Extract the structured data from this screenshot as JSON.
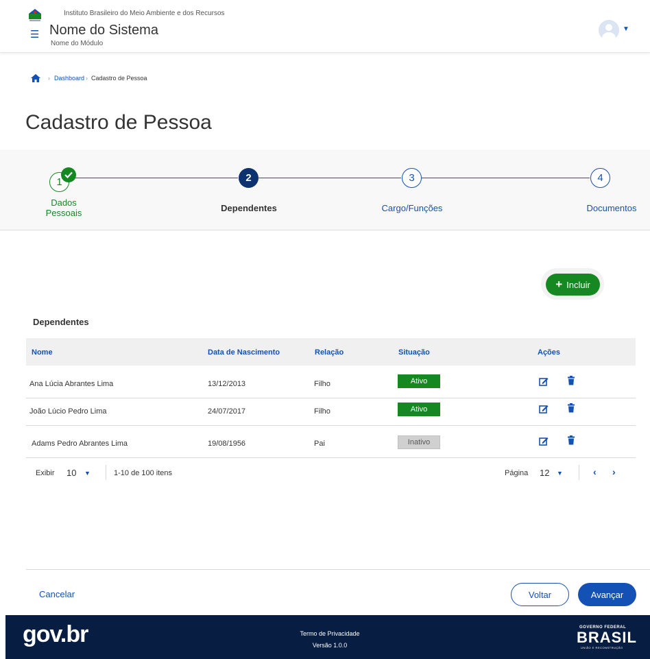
{
  "header": {
    "org_name": "Instituto Brasileiro do Meio Ambiente e dos Recursos",
    "system_name": "Nome do Sistema",
    "module_name": "Nome do Módulo"
  },
  "breadcrumb": {
    "items": [
      "Dashboard",
      "Cadastro de Pessoa"
    ]
  },
  "page": {
    "title": "Cadastro de Pessoa"
  },
  "stepper": {
    "steps": [
      {
        "number": "1",
        "label_line1": "Dados",
        "label_line2": "Pessoais",
        "state": "done"
      },
      {
        "number": "2",
        "label": "Dependentes",
        "state": "current"
      },
      {
        "number": "3",
        "label": "Cargo/Funções",
        "state": "todo"
      },
      {
        "number": "4",
        "label": "Documentos",
        "state": "todo"
      }
    ]
  },
  "toolbar": {
    "add_label": "Incluir"
  },
  "section": {
    "title": "Dependentes"
  },
  "table": {
    "headers": [
      "Nome",
      "Data de Nascimento",
      "Relação",
      "Situação",
      "Ações"
    ],
    "rows": [
      {
        "nome": "Ana Lúcia Abrantes Lima",
        "nascimento": "13/12/2013",
        "relacao": "Filho",
        "situacao": "Ativo"
      },
      {
        "nome": "João Lúcio Pedro Lima",
        "nascimento": "24/07/2017",
        "relacao": "Filho",
        "situacao": "Ativo"
      },
      {
        "nome": "Adams Pedro Abrantes Lima",
        "nascimento": "19/08/1956",
        "relacao": "Pai",
        "situacao": "Inativo"
      }
    ]
  },
  "pagination": {
    "show_label": "Exibir",
    "page_size": "10",
    "range_text": "1-10 de 100 itens",
    "page_label": "Página",
    "current_page": "12"
  },
  "actions": {
    "cancel": "Cancelar",
    "back": "Voltar",
    "next": "Avançar"
  },
  "footer": {
    "logo_text": "gov.br",
    "privacy": "Termo de Privacidade",
    "version": "Versão 1.0.0",
    "brand_top": "GOVERNO FEDERAL",
    "brand_main": "BRASIL",
    "brand_bottom": "UNIÃO E RECONSTRUÇÃO"
  },
  "colors": {
    "primary": "#1351b4",
    "success": "#168821",
    "dark": "#071d41",
    "step_current": "#0c326f"
  }
}
